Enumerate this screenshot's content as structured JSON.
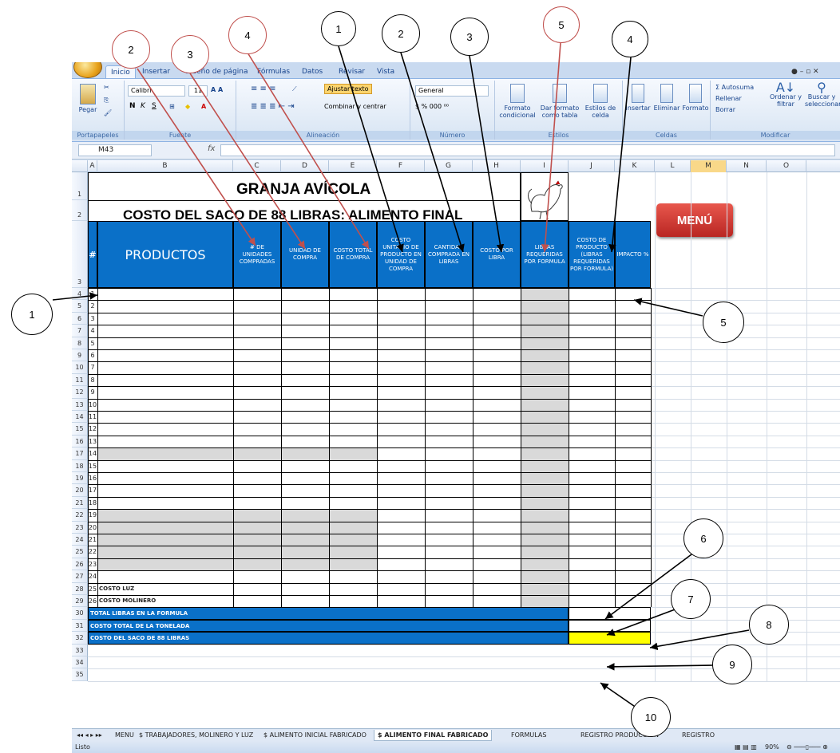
{
  "ribbon": {
    "tabs": [
      "Inicio",
      "Insertar",
      "Diseño de página",
      "Fórmulas",
      "Datos",
      "Revisar",
      "Vista"
    ],
    "paste_label": "Pegar",
    "font_name": "Calibri",
    "font_size": "11",
    "wrap_text": "Ajustar texto",
    "merge_center": "Combinar y centrar",
    "number_format": "General",
    "cond_format": "Formato condicional",
    "format_table": "Dar formato como tabla",
    "cell_styles": "Estilos de celda",
    "insert": "Insertar",
    "delete": "Eliminar",
    "format": "Formato",
    "autosum": "Σ Autosuma",
    "fill": "Rellenar",
    "clear": "Borrar",
    "sort": "Ordenar y filtrar",
    "find": "Buscar y seleccionar",
    "groups": [
      "Portapapeles",
      "Fuente",
      "Alineación",
      "Número",
      "Estilos",
      "Celdas",
      "Modificar"
    ]
  },
  "formula_bar": {
    "name_box": "M43",
    "fx": "fx",
    "value": ""
  },
  "columns": [
    "A",
    "B",
    "C",
    "D",
    "E",
    "F",
    "G",
    "H",
    "I",
    "J",
    "K",
    "L",
    "M",
    "N",
    "O"
  ],
  "sheet": {
    "title1": "GRANJA AVÍCOLA",
    "title2": "COSTO DEL SACO DE 88 LIBRAS: ALIMENTO FINAL",
    "menu_button": "MENÚ",
    "headers": [
      "#",
      "PRODUCTOS",
      "# DE UNIDADES COMPRADAS",
      "UNIDAD DE COMPRA",
      "COSTO TOTAL DE COMPRA",
      "COSTO UNITARIO DE PRODUCTO EN UNIDAD DE COMPRA",
      "CANTIDAD COMPRADA EN LIBRAS",
      "COSTO POR LIBRA",
      "LIBRAS REQUERIDAS POR FORMULA",
      "COSTO DE PRODUCTO (LIBRAS REQUERIDAS POR FORMULA)",
      "IMPACTO %"
    ],
    "row_numbers": [
      "1",
      "2",
      "3",
      "4",
      "5",
      "6",
      "7",
      "8",
      "9",
      "10",
      "11",
      "12",
      "13",
      "14",
      "15",
      "16",
      "17",
      "18",
      "19",
      "20",
      "21",
      "22",
      "23",
      "24",
      "25",
      "26",
      "27",
      "28",
      "29",
      "30",
      "31",
      "32",
      "33",
      "34",
      "35"
    ],
    "item_numbers": [
      "1",
      "2",
      "3",
      "4",
      "5",
      "6",
      "7",
      "8",
      "9",
      "10",
      "11",
      "12",
      "13",
      "14",
      "15",
      "16",
      "17",
      "18",
      "19",
      "20",
      "21",
      "22",
      "23",
      "24",
      "25",
      "26"
    ],
    "product_extra": [
      "COSTO LUZ",
      "COSTO MOLINERO"
    ],
    "totals": [
      "TOTAL LIBRAS EN LA FORMULA",
      "COSTO TOTAL DE LA TONELADA",
      "COSTO DEL SACO DE 88 LIBRAS"
    ]
  },
  "sheet_tabs": [
    "MENU",
    "$ TRABAJADORES, MOLINERO Y LUZ",
    "$ ALIMENTO INICIAL FABRICADO",
    "$ ALIMENTO FINAL FABRICADO",
    "FORMULAS",
    "REGISTRO PRODUCCION",
    "REGISTRO"
  ],
  "status": {
    "ready": "Listo",
    "zoom": "90%"
  },
  "callouts": [
    "2",
    "3",
    "4",
    "1",
    "2",
    "3",
    "5",
    "4",
    "1",
    "5",
    "6",
    "7",
    "8",
    "9",
    "10"
  ]
}
